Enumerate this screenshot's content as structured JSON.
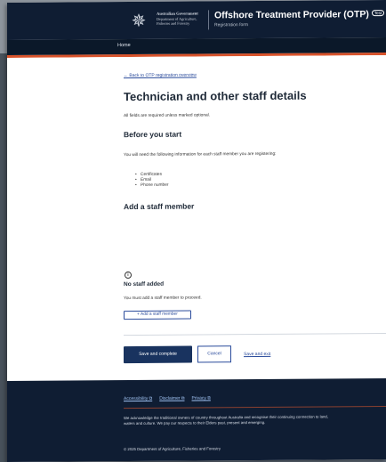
{
  "header": {
    "crest_icon": "commonwealth-coat-of-arms",
    "gov_line1": "Australian Government",
    "gov_line2": "Department of Agriculture,",
    "gov_line3": "Fisheries and Forestry",
    "app_title": "Offshore Treatment Provider (OTP)",
    "badge": "Test",
    "app_subtitle": "Registration form"
  },
  "nav": {
    "home": "Home"
  },
  "main": {
    "back_link": "← Back to OTP registration overview",
    "title": "Technician and other staff details",
    "all_fields": "All fields are required unless marked optional.",
    "before_heading": "Before you start",
    "before_text": "You will need the following information for each staff member you are registering:",
    "requirements": [
      "Certificates",
      "Email",
      "Phone number"
    ],
    "add_heading": "Add a staff member",
    "no_staff_heading": "No staff added",
    "must_add_text": "You must add a staff member to proceed.",
    "add_button": "+ Add a staff member",
    "save_complete": "Save and complete",
    "cancel": "Cancel",
    "save_exit": "Save and exit"
  },
  "footer": {
    "links": [
      "Accessibility ⧉",
      "Disclaimer ⧉",
      "Privacy ⧉"
    ],
    "acknowledgement": "We acknowledge the traditional owners of country throughout Australia and recognise their continuing connection to land, waters and culture. We pay our respects to their Elders past, present and emerging.",
    "copyright": "© 2025 Department of Agriculture, Fisheries and Forestry"
  },
  "colors": {
    "header_bg": "#0f1d33",
    "accent": "#d9532b",
    "primary_button": "#19335f",
    "link": "#2a4b9b"
  }
}
